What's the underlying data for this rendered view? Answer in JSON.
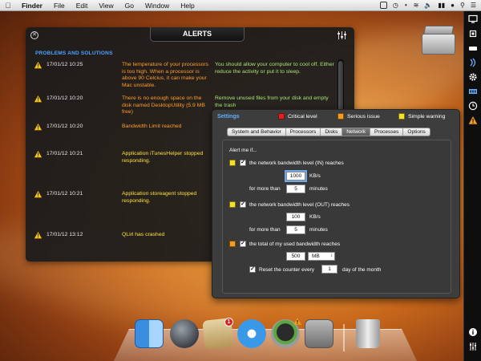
{
  "menubar": {
    "items": [
      "Finder",
      "File",
      "Edit",
      "View",
      "Go",
      "Window",
      "Help"
    ]
  },
  "alerts": {
    "title": "ALERTS",
    "section_title": "PROBLEMS AND SOLUTIONS",
    "rows": [
      {
        "time": "17/01/12 10:25",
        "severity": "serious",
        "message": "The temperature of your processors is too high. When a processor is above 90 Celcius, it can make your Mac unstable.",
        "solution": "You should allow your computer to cool off. Either reduce the activity or put it to sleep."
      },
      {
        "time": "17/01/12 10:20",
        "severity": "serious",
        "message": "There is no enough space on the disk named DesktopUtility (5.9 MB free)",
        "solution": "Remove unused files from your disk and empty the trash"
      },
      {
        "time": "17/01/12 10:20",
        "severity": "serious",
        "message": "Bandwidth Limit reached",
        "solution": ""
      },
      {
        "time": "17/01/12 10:21",
        "severity": "warning",
        "message": "Application iTunesHelper stopped responding.",
        "solution": ""
      },
      {
        "time": "17/01/12 10:21",
        "severity": "warning",
        "message": "Application storeagent stopped responding.",
        "solution": ""
      },
      {
        "time": "17/01/12 13:12",
        "severity": "warning",
        "message": "QLirl has crashed",
        "solution": ""
      }
    ]
  },
  "settings": {
    "title": "Settings",
    "legend": {
      "critical": "Critical level",
      "serious": "Serious issue",
      "warning": "Simple warning"
    },
    "tabs": [
      "System and Behavior",
      "Processors",
      "Disks",
      "Network",
      "Processes",
      "Options"
    ],
    "active_tab": "Network",
    "alert_me": "Alert me if...",
    "rule_in": {
      "label": "the network bandwidth level (IN) reaches",
      "value": "1000",
      "unit": "KB/s",
      "for_label": "for more than",
      "minutes": "5",
      "minutes_label": "minutes"
    },
    "rule_out": {
      "label": "the network bandwidth level (OUT) reaches",
      "value": "100",
      "unit": "KB/s",
      "for_label": "for more than",
      "minutes": "5",
      "minutes_label": "minutes"
    },
    "rule_total": {
      "label": "the total of my used bandwidth reaches",
      "value": "500",
      "unit": "MB"
    },
    "reset": {
      "label": "Reset the counter every",
      "value": "1",
      "suffix": "day of the month"
    }
  },
  "dock": {
    "mail_badge": "1"
  },
  "colors": {
    "critical": "#e0201c",
    "serious": "#f39c1e",
    "warning": "#f5e02a",
    "section_blue": "#4aa3ff",
    "solution_green": "#a8e07a"
  }
}
